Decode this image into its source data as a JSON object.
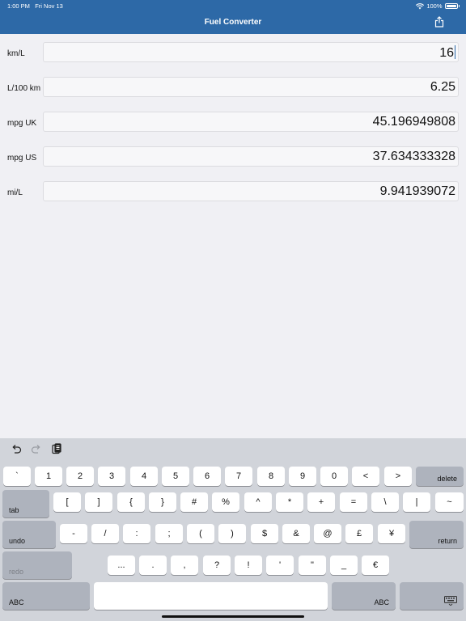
{
  "status": {
    "time": "1:00 PM",
    "date": "Fri Nov 13",
    "battery": "100%"
  },
  "nav": {
    "title": "Fuel Converter"
  },
  "fields": [
    {
      "label": "km/L",
      "value": "16"
    },
    {
      "label": "L/100 km",
      "value": "6.25"
    },
    {
      "label": "mpg UK",
      "value": "45.196949808"
    },
    {
      "label": "mpg US",
      "value": "37.634333328"
    },
    {
      "label": "mi/L",
      "value": "9.941939072"
    }
  ],
  "keyboard": {
    "row1": [
      "`",
      "1",
      "2",
      "3",
      "4",
      "5",
      "6",
      "7",
      "8",
      "9",
      "0",
      "<",
      ">"
    ],
    "delete": "delete",
    "tab": "tab",
    "row2": [
      "[",
      "]",
      "{",
      "}",
      "#",
      "%",
      "^",
      "*",
      "+",
      "=",
      "\\",
      "|",
      "~"
    ],
    "undo": "undo",
    "row3": [
      "-",
      "/",
      ":",
      ";",
      "(",
      ")",
      "$",
      "&",
      "@",
      "£",
      "¥"
    ],
    "return": "return",
    "redo": "redo",
    "row4": [
      "...",
      ".",
      ",",
      "?",
      "!",
      "'",
      "\"",
      "_",
      "€"
    ],
    "abc_left": "ABC",
    "abc_right": "ABC",
    "space": ""
  }
}
